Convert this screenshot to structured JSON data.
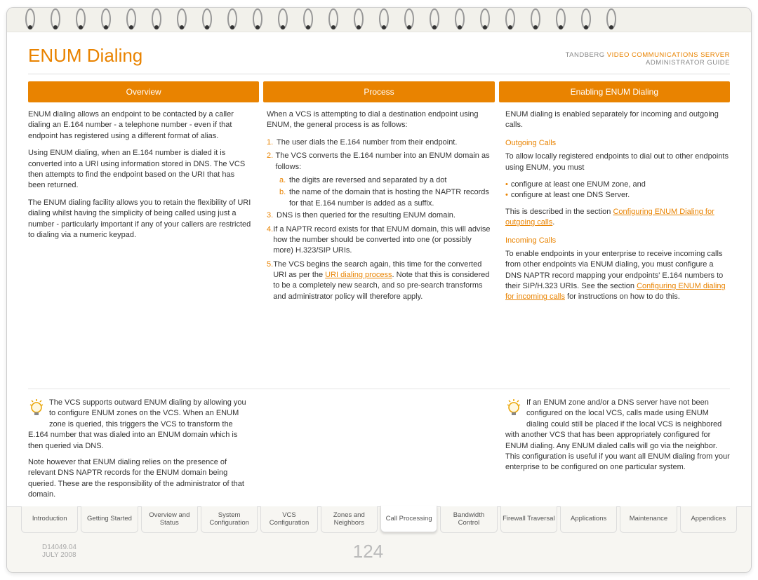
{
  "header": {
    "title": "ENUM Dialing",
    "brand": "TANDBERG",
    "product": "VIDEO COMMUNICATIONS SERVER",
    "doc_type": "ADMINISTRATOR GUIDE"
  },
  "columns": {
    "headers": [
      "Overview",
      "Process",
      "Enabling ENUM Dialing"
    ],
    "overview": {
      "p1": "ENUM dialing allows an endpoint to be contacted by a caller dialing an E.164 number - a telephone number - even if that endpoint has registered using a different format of alias.",
      "p2": "Using ENUM dialing, when an E.164 number is dialed it is converted into a URI using information stored in DNS.  The VCS then attempts to find the endpoint based on the URI that has been returned.",
      "p3": "The ENUM dialing facility allows you to retain the flexibility of URI dialing whilst having the simplicity of being called using just a number - particularly important if any of your callers are restricted to dialing via a numeric keypad."
    },
    "process": {
      "intro": "When a VCS is attempting to dial a destination endpoint using ENUM, the general process is as follows:",
      "steps": [
        "The user dials the E.164 number from their endpoint.",
        "The VCS converts the E.164 number into an ENUM domain as follows:",
        "DNS is then queried for the resulting ENUM domain.",
        "If a NAPTR record exists for that ENUM domain, this will advise how the number should be converted into one (or possibly more) H.323/SIP URIs."
      ],
      "sub_steps": [
        "the digits are reversed and separated by a dot",
        "the name of the domain that is hosting the NAPTR records for that E.164 number is added as a suffix."
      ],
      "step5_pre": "The VCS begins the search again, this time for the converted URI as per the ",
      "step5_link": "URI dialing process",
      "step5_post": ".  Note that this is considered to be a completely new search, and so pre-search transforms and administrator policy will therefore apply."
    },
    "enabling": {
      "intro": "ENUM dialing is enabled separately for incoming and outgoing calls.",
      "out_head": "Outgoing Calls",
      "out_p1": "To allow locally registered endpoints to dial out to other endpoints using ENUM, you must",
      "out_b1": "configure at least one ENUM zone, and",
      "out_b2": "configure at least one DNS Server.",
      "out_p2_pre": "This is described in the section  ",
      "out_link": "Configuring ENUM Dialing for outgoing calls",
      "out_p2_post": ".",
      "in_head": "Incoming Calls",
      "in_p1_pre": "To enable endpoints in your enterprise to receive incoming calls from other endpoints via ENUM dialing, you must configure a DNS NAPTR record mapping your endpoints' E.164 numbers to their SIP/H.323 URIs.  See the section ",
      "in_link": "Configuring ENUM dialing for incoming calls",
      "in_p1_post": " for instructions on how to do this."
    }
  },
  "tips": {
    "left": {
      "p1": "The VCS supports outward ENUM dialing by allowing you to configure ENUM zones on the VCS.  When an ENUM zone is queried, this triggers the VCS to transform the E.164 number that was dialed into an ENUM domain which is then queried via DNS.",
      "p2": "Note however that ENUM dialing relies on the presence of relevant DNS NAPTR records for the ENUM domain being queried.  These are the responsibility of the administrator of that domain."
    },
    "right": {
      "p1": "If an ENUM zone and/or a DNS server have not been configured on the local VCS, calls made using ENUM dialing could still be placed if the local VCS is neighbored with another VCS that has been appropriately configured for ENUM dialing. Any ENUM dialed calls will go via the neighbor. This configuration is useful if you want all ENUM dialing from your enterprise to be configured on one particular system."
    }
  },
  "tabs": [
    {
      "label": "Introduction",
      "active": false
    },
    {
      "label": "Getting Started",
      "active": false
    },
    {
      "label": "Overview and Status",
      "active": false
    },
    {
      "label": "System Configuration",
      "active": false
    },
    {
      "label": "VCS Configuration",
      "active": false
    },
    {
      "label": "Zones and Neighbors",
      "active": false
    },
    {
      "label": "Call Processing",
      "active": true
    },
    {
      "label": "Bandwidth Control",
      "active": false
    },
    {
      "label": "Firewall Traversal",
      "active": false
    },
    {
      "label": "Applications",
      "active": false
    },
    {
      "label": "Maintenance",
      "active": false
    },
    {
      "label": "Appendices",
      "active": false
    }
  ],
  "footer": {
    "doc_id": "D14049.04",
    "date": "JULY 2008",
    "page": "124"
  }
}
